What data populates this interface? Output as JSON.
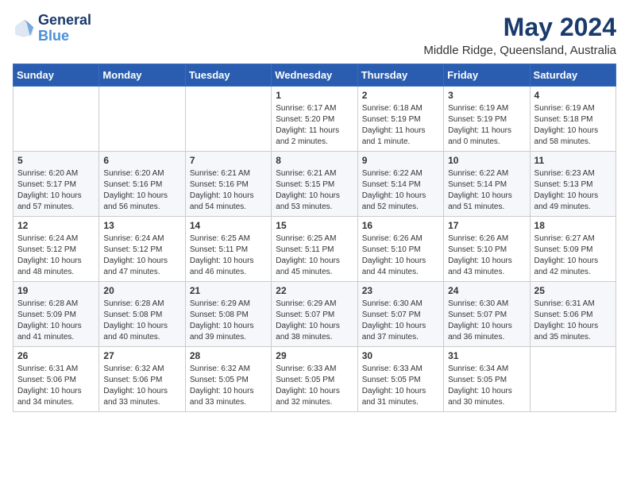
{
  "logo": {
    "line1": "General",
    "line2": "Blue"
  },
  "title": "May 2024",
  "location": "Middle Ridge, Queensland, Australia",
  "days_of_week": [
    "Sunday",
    "Monday",
    "Tuesday",
    "Wednesday",
    "Thursday",
    "Friday",
    "Saturday"
  ],
  "weeks": [
    [
      {
        "day": "",
        "info": ""
      },
      {
        "day": "",
        "info": ""
      },
      {
        "day": "",
        "info": ""
      },
      {
        "day": "1",
        "info": "Sunrise: 6:17 AM\nSunset: 5:20 PM\nDaylight: 11 hours\nand 2 minutes."
      },
      {
        "day": "2",
        "info": "Sunrise: 6:18 AM\nSunset: 5:19 PM\nDaylight: 11 hours\nand 1 minute."
      },
      {
        "day": "3",
        "info": "Sunrise: 6:19 AM\nSunset: 5:19 PM\nDaylight: 11 hours\nand 0 minutes."
      },
      {
        "day": "4",
        "info": "Sunrise: 6:19 AM\nSunset: 5:18 PM\nDaylight: 10 hours\nand 58 minutes."
      }
    ],
    [
      {
        "day": "5",
        "info": "Sunrise: 6:20 AM\nSunset: 5:17 PM\nDaylight: 10 hours\nand 57 minutes."
      },
      {
        "day": "6",
        "info": "Sunrise: 6:20 AM\nSunset: 5:16 PM\nDaylight: 10 hours\nand 56 minutes."
      },
      {
        "day": "7",
        "info": "Sunrise: 6:21 AM\nSunset: 5:16 PM\nDaylight: 10 hours\nand 54 minutes."
      },
      {
        "day": "8",
        "info": "Sunrise: 6:21 AM\nSunset: 5:15 PM\nDaylight: 10 hours\nand 53 minutes."
      },
      {
        "day": "9",
        "info": "Sunrise: 6:22 AM\nSunset: 5:14 PM\nDaylight: 10 hours\nand 52 minutes."
      },
      {
        "day": "10",
        "info": "Sunrise: 6:22 AM\nSunset: 5:14 PM\nDaylight: 10 hours\nand 51 minutes."
      },
      {
        "day": "11",
        "info": "Sunrise: 6:23 AM\nSunset: 5:13 PM\nDaylight: 10 hours\nand 49 minutes."
      }
    ],
    [
      {
        "day": "12",
        "info": "Sunrise: 6:24 AM\nSunset: 5:12 PM\nDaylight: 10 hours\nand 48 minutes."
      },
      {
        "day": "13",
        "info": "Sunrise: 6:24 AM\nSunset: 5:12 PM\nDaylight: 10 hours\nand 47 minutes."
      },
      {
        "day": "14",
        "info": "Sunrise: 6:25 AM\nSunset: 5:11 PM\nDaylight: 10 hours\nand 46 minutes."
      },
      {
        "day": "15",
        "info": "Sunrise: 6:25 AM\nSunset: 5:11 PM\nDaylight: 10 hours\nand 45 minutes."
      },
      {
        "day": "16",
        "info": "Sunrise: 6:26 AM\nSunset: 5:10 PM\nDaylight: 10 hours\nand 44 minutes."
      },
      {
        "day": "17",
        "info": "Sunrise: 6:26 AM\nSunset: 5:10 PM\nDaylight: 10 hours\nand 43 minutes."
      },
      {
        "day": "18",
        "info": "Sunrise: 6:27 AM\nSunset: 5:09 PM\nDaylight: 10 hours\nand 42 minutes."
      }
    ],
    [
      {
        "day": "19",
        "info": "Sunrise: 6:28 AM\nSunset: 5:09 PM\nDaylight: 10 hours\nand 41 minutes."
      },
      {
        "day": "20",
        "info": "Sunrise: 6:28 AM\nSunset: 5:08 PM\nDaylight: 10 hours\nand 40 minutes."
      },
      {
        "day": "21",
        "info": "Sunrise: 6:29 AM\nSunset: 5:08 PM\nDaylight: 10 hours\nand 39 minutes."
      },
      {
        "day": "22",
        "info": "Sunrise: 6:29 AM\nSunset: 5:07 PM\nDaylight: 10 hours\nand 38 minutes."
      },
      {
        "day": "23",
        "info": "Sunrise: 6:30 AM\nSunset: 5:07 PM\nDaylight: 10 hours\nand 37 minutes."
      },
      {
        "day": "24",
        "info": "Sunrise: 6:30 AM\nSunset: 5:07 PM\nDaylight: 10 hours\nand 36 minutes."
      },
      {
        "day": "25",
        "info": "Sunrise: 6:31 AM\nSunset: 5:06 PM\nDaylight: 10 hours\nand 35 minutes."
      }
    ],
    [
      {
        "day": "26",
        "info": "Sunrise: 6:31 AM\nSunset: 5:06 PM\nDaylight: 10 hours\nand 34 minutes."
      },
      {
        "day": "27",
        "info": "Sunrise: 6:32 AM\nSunset: 5:06 PM\nDaylight: 10 hours\nand 33 minutes."
      },
      {
        "day": "28",
        "info": "Sunrise: 6:32 AM\nSunset: 5:05 PM\nDaylight: 10 hours\nand 33 minutes."
      },
      {
        "day": "29",
        "info": "Sunrise: 6:33 AM\nSunset: 5:05 PM\nDaylight: 10 hours\nand 32 minutes."
      },
      {
        "day": "30",
        "info": "Sunrise: 6:33 AM\nSunset: 5:05 PM\nDaylight: 10 hours\nand 31 minutes."
      },
      {
        "day": "31",
        "info": "Sunrise: 6:34 AM\nSunset: 5:05 PM\nDaylight: 10 hours\nand 30 minutes."
      },
      {
        "day": "",
        "info": ""
      }
    ]
  ]
}
